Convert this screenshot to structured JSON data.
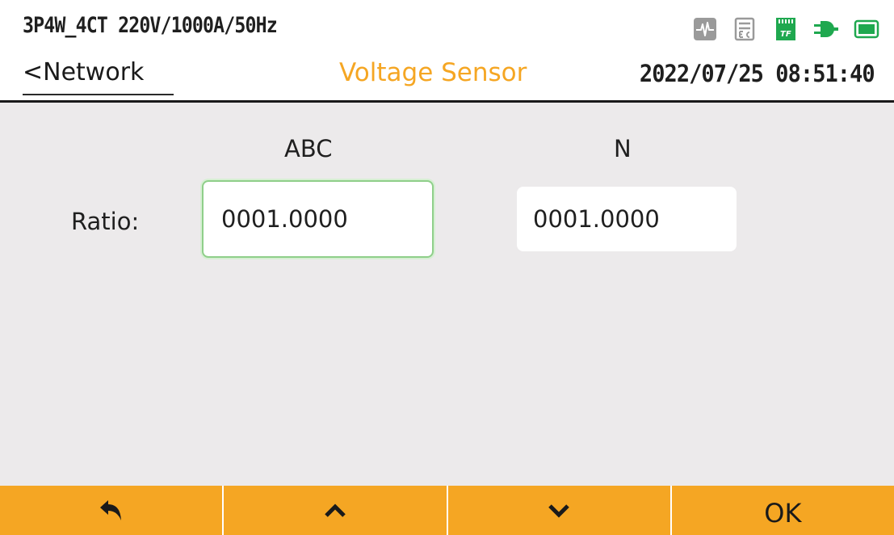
{
  "header": {
    "config": "3P4W_4CT 220V/1000A/50Hz",
    "back_label": "<Network",
    "page_title": "Voltage Sensor",
    "datetime": "2022/07/25 08:51:40",
    "status_icons": [
      "waveform-icon",
      "record-icon",
      "tf-card-icon",
      "power-plug-icon",
      "battery-icon"
    ],
    "colors": {
      "title": "#f5a623",
      "status_active": "#1fa84f",
      "status_inactive": "#9a9a9a"
    }
  },
  "main": {
    "columns": [
      "ABC",
      "N"
    ],
    "ratio_label": "Ratio:",
    "ratio_abc": "0001.0000",
    "ratio_n": "0001.0000",
    "colors": {
      "background": "#eceaeb",
      "focus_border": "#8fcf8a"
    }
  },
  "softkeys": {
    "items": [
      {
        "icon": "return-arrow-icon"
      },
      {
        "icon": "chevron-up-icon"
      },
      {
        "icon": "chevron-down-icon"
      },
      {
        "label": "OK"
      }
    ],
    "color": "#f5a623"
  }
}
